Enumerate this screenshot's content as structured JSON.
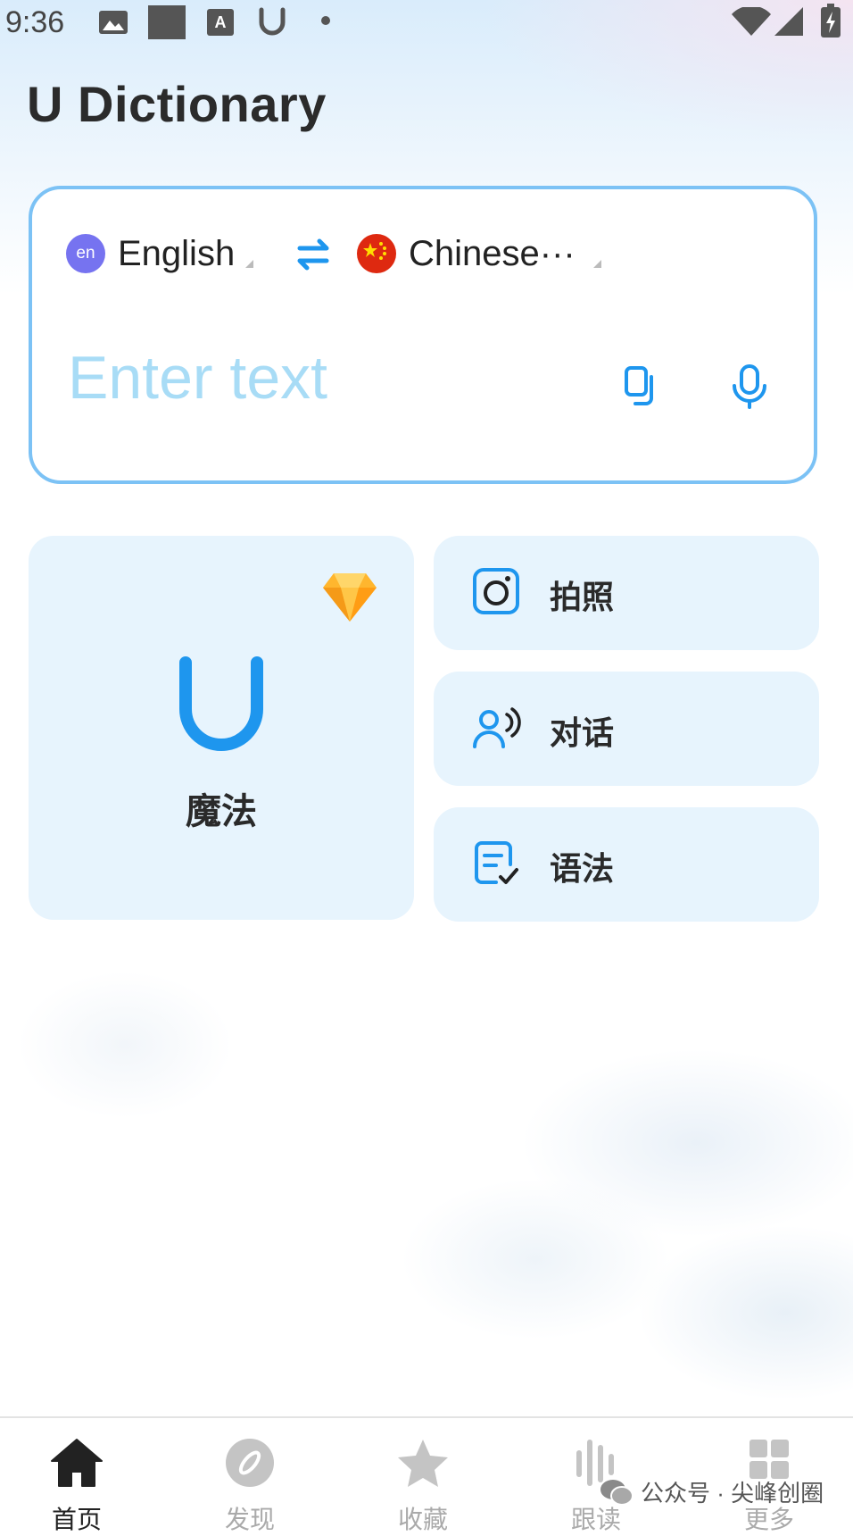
{
  "status_bar": {
    "time": "9:36",
    "icons": [
      "image-icon",
      "square-icon",
      "a-font-icon",
      "u-dictionary-notification-icon",
      "dot-icon",
      "wifi-icon",
      "signal-icon",
      "battery-charging-icon"
    ]
  },
  "header": {
    "title": "U Dictionary"
  },
  "translator": {
    "source_lang": {
      "badge": "en",
      "label": "English"
    },
    "target_lang": {
      "label": "Chinese···"
    },
    "placeholder": "Enter text",
    "icons": [
      "swap-icon",
      "china-flag-icon",
      "ocr-copy-icon",
      "microphone-icon"
    ]
  },
  "features": {
    "magic": {
      "label": "魔法",
      "icons": [
        "diamond-icon",
        "u-logo-icon"
      ]
    },
    "photo": {
      "label": "拍照",
      "icon": "camera-icon"
    },
    "dialog": {
      "label": "对话",
      "icon": "conversation-icon"
    },
    "grammar": {
      "label": "语法",
      "icon": "grammar-check-icon"
    }
  },
  "bottom_nav": {
    "items": [
      {
        "label": "首页",
        "icon": "home-icon",
        "active": true
      },
      {
        "label": "发现",
        "icon": "compass-icon",
        "active": false
      },
      {
        "label": "收藏",
        "icon": "star-icon",
        "active": false
      },
      {
        "label": "跟读",
        "icon": "audio-bars-icon",
        "active": false
      },
      {
        "label": "更多",
        "icon": "grid-icon",
        "active": false
      }
    ]
  },
  "watermark": {
    "text": "公众号 · 尖峰创圈"
  },
  "colors": {
    "accent": "#1e96ee",
    "placeholder": "#a8dcf6",
    "tile_bg": "#e7f4fd",
    "card_border": "#7cc2f5"
  }
}
